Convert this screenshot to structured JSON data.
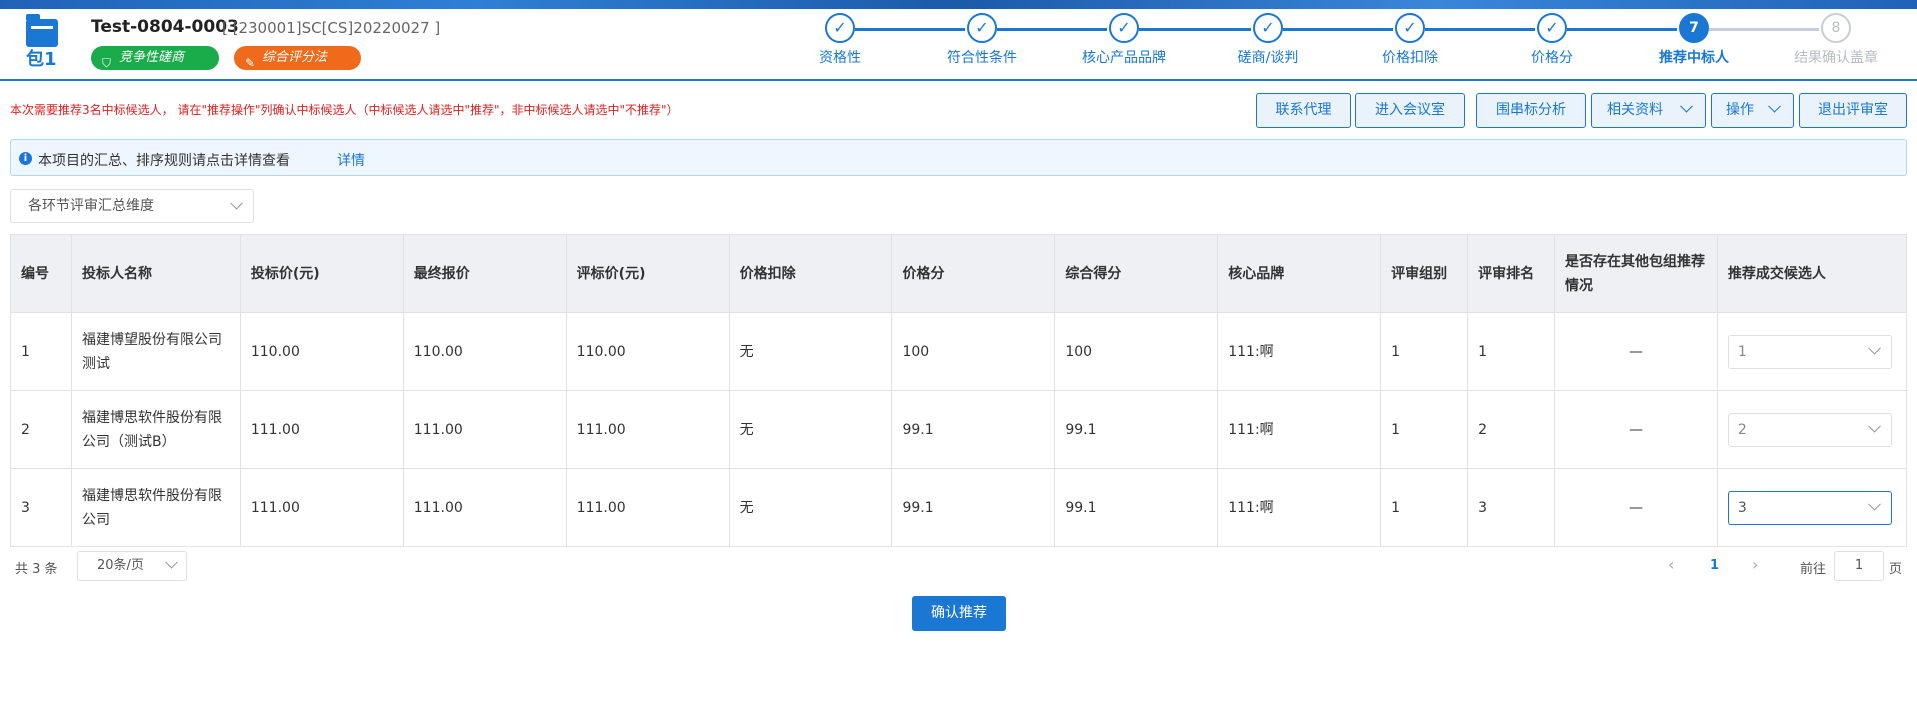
{
  "header": {
    "package_label": "包1",
    "project_title": "Test-0804-0003",
    "project_code": "[ [230001]SC[CS]20220027 ]",
    "tag_method": "竞争性磋商",
    "tag_evaluation": "综合评分法"
  },
  "steps": [
    {
      "label": "资格性",
      "state": "done",
      "mark": "✓"
    },
    {
      "label": "符合性条件",
      "state": "done",
      "mark": "✓"
    },
    {
      "label": "核心产品品牌",
      "state": "done",
      "mark": "✓"
    },
    {
      "label": "磋商/谈判",
      "state": "done",
      "mark": "✓"
    },
    {
      "label": "价格扣除",
      "state": "done",
      "mark": "✓"
    },
    {
      "label": "价格分",
      "state": "done",
      "mark": "✓"
    },
    {
      "label": "推荐中标人",
      "state": "active",
      "mark": "7"
    },
    {
      "label": "结果确认盖章",
      "state": "pending",
      "mark": "8"
    }
  ],
  "notice": "本次需要推荐3名中标候选人， 请在\"推荐操作\"列确认中标候选人（中标候选人请选中\"推荐\"，非中标候选人请选中\"不推荐\"）",
  "toolbar": {
    "contact_agent": "联系代理",
    "enter_room": "进入会议室",
    "collusion_analysis": "围串标分析",
    "related_docs": "相关资料",
    "operations": "操作",
    "exit_room": "退出评审室"
  },
  "info": {
    "text": "本项目的汇总、排序规则请点击详情查看",
    "link": "详情"
  },
  "dimension_select": {
    "value": "各环节评审汇总维度"
  },
  "table": {
    "headers": [
      "编号",
      "投标人名称",
      "投标价(元)",
      "最终报价",
      "评标价(元)",
      "价格扣除",
      "价格分",
      "综合得分",
      "核心品牌",
      "评审组别",
      "评审排名",
      "是否存在其他包组推荐情况",
      "推荐成交候选人"
    ],
    "rows": [
      {
        "no": "1",
        "name": "福建博望股份有限公司测试",
        "bid": "110.00",
        "final": "110.00",
        "eval": "110.00",
        "deduct": "无",
        "price_score": "100",
        "total": "100",
        "brand": "111:啊",
        "group": "1",
        "rank": "1",
        "other": "—",
        "recommend": "1"
      },
      {
        "no": "2",
        "name": "福建博思软件股份有限公司（测试B）",
        "bid": "111.00",
        "final": "111.00",
        "eval": "111.00",
        "deduct": "无",
        "price_score": "99.1",
        "total": "99.1",
        "brand": "111:啊",
        "group": "1",
        "rank": "2",
        "other": "—",
        "recommend": "2"
      },
      {
        "no": "3",
        "name": "福建博思软件股份有限公司",
        "bid": "111.00",
        "final": "111.00",
        "eval": "111.00",
        "deduct": "无",
        "price_score": "99.1",
        "total": "99.1",
        "brand": "111:啊",
        "group": "1",
        "rank": "3",
        "other": "—",
        "recommend": "3"
      }
    ]
  },
  "pager": {
    "total": "共 3 条",
    "page_size": "20条/页",
    "current_page": "1",
    "goto_label": "前往",
    "goto_value": "1",
    "page_unit": "页"
  },
  "confirm_button": "确认推荐",
  "colors": {
    "primary": "#1a78d4",
    "green": "#1aab4a",
    "orange": "#ef6a1a",
    "notice": "#e02020"
  }
}
